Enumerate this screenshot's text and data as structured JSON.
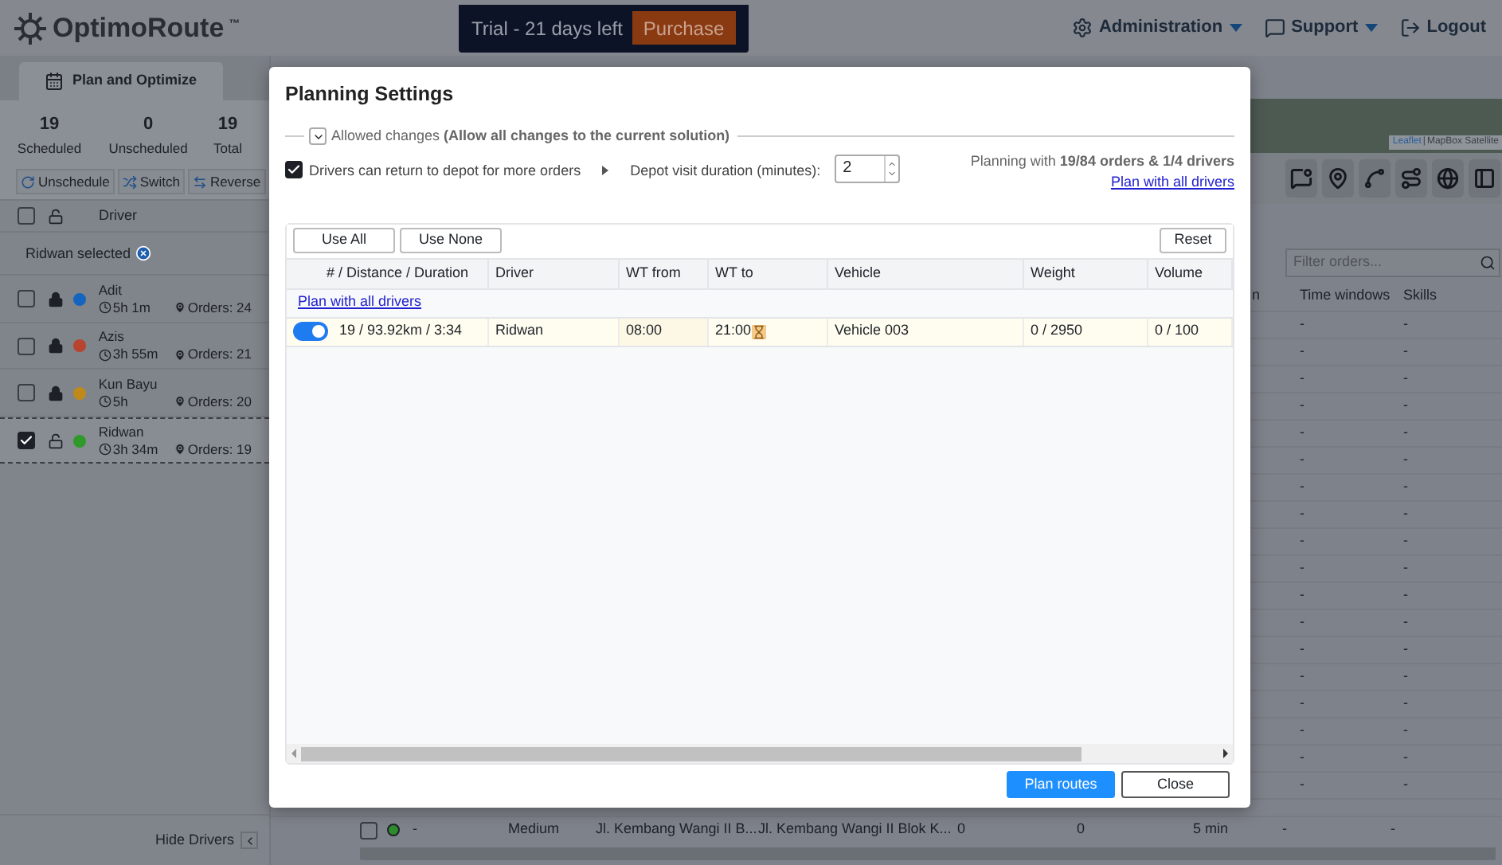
{
  "header": {
    "logo": "OptimoRoute",
    "trademark": "™",
    "trial": "Trial - 21 days left",
    "purchase": "Purchase",
    "menu": [
      {
        "label": "Administration",
        "dropdown": true
      },
      {
        "label": "Support",
        "dropdown": true
      },
      {
        "label": "Logout",
        "dropdown": false
      }
    ]
  },
  "sidebar": {
    "tab": {
      "label": "Plan and Optimize",
      "selected": true
    },
    "stats": [
      {
        "value": "19",
        "label": "Scheduled"
      },
      {
        "value": "0",
        "label": "Unscheduled"
      },
      {
        "value": "19",
        "label": "Total"
      }
    ],
    "actions": [
      "Unschedule",
      "Switch",
      "Reverse"
    ],
    "header_checked": false,
    "column": "Driver",
    "selection": "Ridwan selected",
    "drivers": [
      {
        "name": "Adit",
        "duration": "5h 1m",
        "orders": "Orders: 24",
        "color": "#1565c0",
        "locked": true,
        "checked": false
      },
      {
        "name": "Azis",
        "duration": "3h 55m",
        "orders": "Orders: 21",
        "color": "#b8432f",
        "locked": true,
        "checked": false
      },
      {
        "name": "Kun Bayu",
        "duration": "5h",
        "orders": "Orders: 20",
        "color": "#c08a1a",
        "locked": true,
        "checked": false
      },
      {
        "name": "Ridwan",
        "duration": "3h 34m",
        "orders": "Orders: 19",
        "color": "#2f9a2a",
        "locked": false,
        "checked": true
      }
    ],
    "hide_drivers": "Hide Drivers"
  },
  "map": {
    "attribution_link": "Leaflet",
    "separator": "|",
    "attribution": "MapBox Satellite"
  },
  "orders": {
    "filter_placeholder": "Filter orders...",
    "columns": [
      "n",
      "Time windows",
      "Skills"
    ],
    "rows": [
      [
        "",
        "-",
        "-"
      ],
      [
        "",
        "-",
        "-"
      ],
      [
        "",
        "-",
        "-"
      ],
      [
        "",
        "-",
        "-"
      ],
      [
        "",
        "-",
        "-"
      ],
      [
        "",
        "-",
        "-"
      ],
      [
        "",
        "-",
        "-"
      ],
      [
        "",
        "-",
        "-"
      ],
      [
        "",
        "-",
        "-"
      ],
      [
        "",
        "-",
        "-"
      ],
      [
        "",
        "-",
        "-"
      ],
      [
        "",
        "-",
        "-"
      ],
      [
        "",
        "-",
        "-"
      ],
      [
        "",
        "-",
        "-"
      ],
      [
        "",
        "-",
        "-"
      ],
      [
        "",
        "-",
        "-"
      ],
      [
        "",
        "-",
        "-"
      ],
      [
        "",
        "-",
        "-"
      ]
    ],
    "last_row": {
      "checked": false,
      "color": "#2e8b2e",
      "cells": [
        "-",
        "Medium",
        "Jl. Kembang Wangi II B...",
        "Jl. Kembang Wangi II Blok K...",
        "0",
        "0",
        "5 min",
        "-",
        "-"
      ]
    }
  },
  "dialog": {
    "title": "Planning Settings",
    "allowed_changes": {
      "text": "Allowed changes **(Allow all changes to the current solution)**",
      "expanded": false
    },
    "return_to_depot": {
      "label": "Drivers can return to depot for more orders",
      "checked": true
    },
    "depot_visit": {
      "label": "Depot visit duration (minutes):",
      "value": "2"
    },
    "summary": "Planning with **19/84 orders & 1/4 drivers**",
    "summary_link": "Plan with all drivers",
    "table_buttons": [
      "Use All",
      "Use None"
    ],
    "reset": "Reset",
    "columns": [
      "# / Distance / Duration",
      "Driver",
      "WT from",
      "WT to",
      "Vehicle",
      "Weight",
      "Volume"
    ],
    "link_row": "Plan with all drivers",
    "rows": [
      {
        "enabled": true,
        "cells": [
          "19 / 93.92km / 3:34",
          "Ridwan",
          "08:00",
          "21:00",
          "Vehicle 003",
          "0 / 2950",
          "0 / 100"
        ]
      }
    ],
    "plan": "Plan routes",
    "close": "Close"
  }
}
